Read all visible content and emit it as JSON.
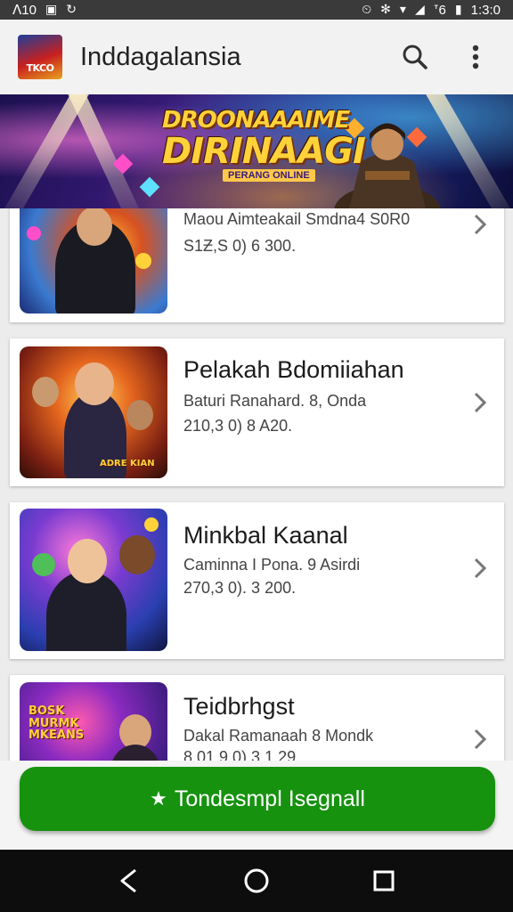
{
  "status_bar": {
    "left_text": "ᐱ10",
    "time": "1:3:0",
    "battery_label": "ᐪ6"
  },
  "app_bar": {
    "logo_text": "TKCO",
    "title": "Inddagalansia",
    "icons": [
      "search-icon",
      "more-vert-icon"
    ]
  },
  "banner": {
    "title_line1": "DROONAAAIME",
    "title_line2": "DIRINAAGI",
    "subtitle": "PERANG ONLINE"
  },
  "cards": [
    {
      "title": "",
      "line1": "Maou Aimteakail Smdna4 S0R0",
      "line2": "S1Ƶ,S 0) 6 300.",
      "thumb_label": ""
    },
    {
      "title": "Pelakah Bdomiiahan",
      "line1": "Baturi Ranahard. 8, Onda",
      "line2": "210,3 0) 8 A20.",
      "thumb_label": "ADRE KIAN"
    },
    {
      "title": "Minkbal Kaanal",
      "line1": "Caminna I Pona. 9 Asirdi",
      "line2": "270,3 0). 3 200.",
      "thumb_label": ""
    },
    {
      "title": "Teidbrhgst",
      "line1": "Dakal Ramanaah 8 Mondk",
      "line2": "8 01 9 0) 3 1 29",
      "thumb_label": "BOSK MURMK MKEANS"
    }
  ],
  "cta": {
    "label": "Tondesmpl Isegnall",
    "color": "#16920f"
  },
  "nav_bar": {
    "icons": [
      "back-icon",
      "home-icon",
      "recents-icon"
    ]
  },
  "colors": {
    "accent": "#16920f",
    "banner_title": "#ffd23a"
  }
}
